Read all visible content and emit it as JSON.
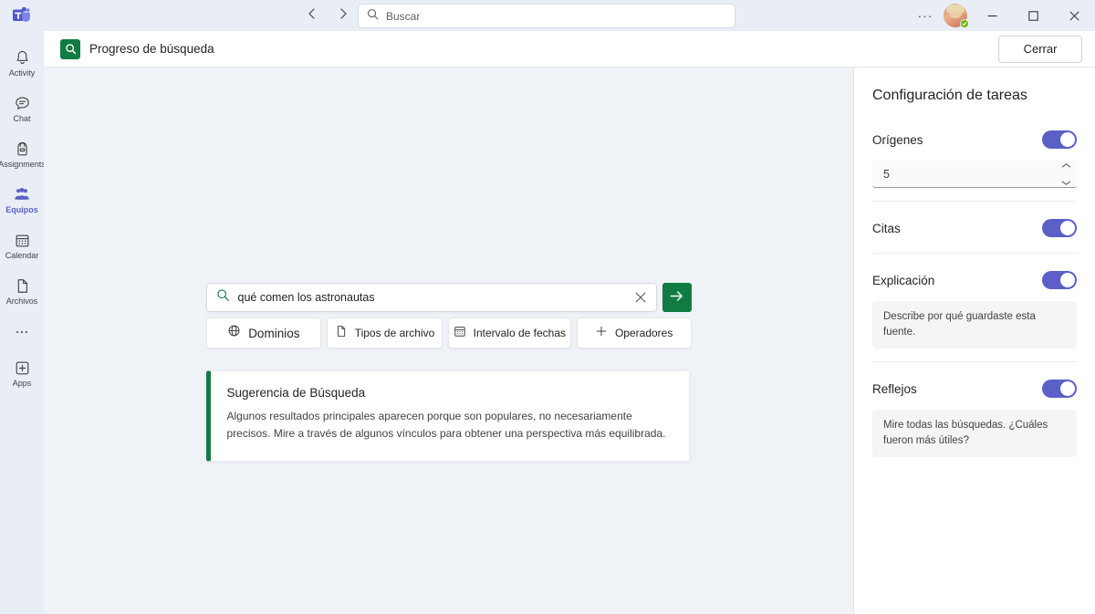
{
  "titlebar": {
    "logo_name": "microsoft-teams-logo",
    "back_icon": "chevron-left-icon",
    "forward_icon": "chevron-right-icon",
    "search_placeholder": "Buscar",
    "search_value": "",
    "more_label": "···",
    "minimize_label": "—",
    "maximize_label": "□",
    "close_label": "✕",
    "presence_status": "available"
  },
  "rail": {
    "items": [
      {
        "label": "Activity",
        "icon": "bell-icon",
        "active": false
      },
      {
        "label": "Chat",
        "icon": "chat-icon",
        "active": false
      },
      {
        "label": "Assignments",
        "icon": "backpack-icon",
        "active": false
      },
      {
        "label": "Equipos",
        "icon": "people-icon",
        "active": true
      },
      {
        "label": "Calendar",
        "icon": "calendar-icon",
        "active": false
      },
      {
        "label": "Archivos",
        "icon": "file-icon",
        "active": false
      }
    ],
    "more_label": "···",
    "apps_label": "Apps",
    "apps_icon": "plus-square-icon"
  },
  "app_header": {
    "icon": "green-search-app-icon",
    "title": "Progreso de búsqueda",
    "close_label": "Cerrar"
  },
  "search": {
    "icon": "search-icon",
    "query": "qué comen los astronautas",
    "clear_icon": "close-icon",
    "submit_icon": "arrow-right-icon",
    "chips": [
      {
        "label": "Dominios",
        "icon": "globe-icon"
      },
      {
        "label": "Tipos de archivo",
        "icon": "document-icon"
      },
      {
        "label": "Intervalo de fechas",
        "icon": "calendar-icon"
      },
      {
        "label": "Operadores",
        "icon": "plus-icon"
      }
    ]
  },
  "tip_card": {
    "title": "Sugerencia de Búsqueda",
    "body": "Algunos resultados principales aparecen porque son populares, no necesariamente precisos. Mire a través de algunos vínculos para obtener una perspectiva más equilibrada.",
    "accent_color": "#107c41"
  },
  "right_panel": {
    "title": "Configuración de tareas",
    "accent_color": "#5b5fc7",
    "settings": [
      {
        "label": "Orígenes",
        "enabled": true,
        "spinner_value": "5",
        "up_icon": "chevron-up-icon",
        "down_icon": "chevron-down-icon"
      },
      {
        "label": "Citas",
        "enabled": true
      },
      {
        "label": "Explicación",
        "enabled": true,
        "hint": "Describe por qué guardaste esta fuente."
      },
      {
        "label": "Reflejos",
        "enabled": true,
        "hint": "Mire todas las búsquedas. ¿Cuáles fueron más útiles?"
      }
    ]
  }
}
